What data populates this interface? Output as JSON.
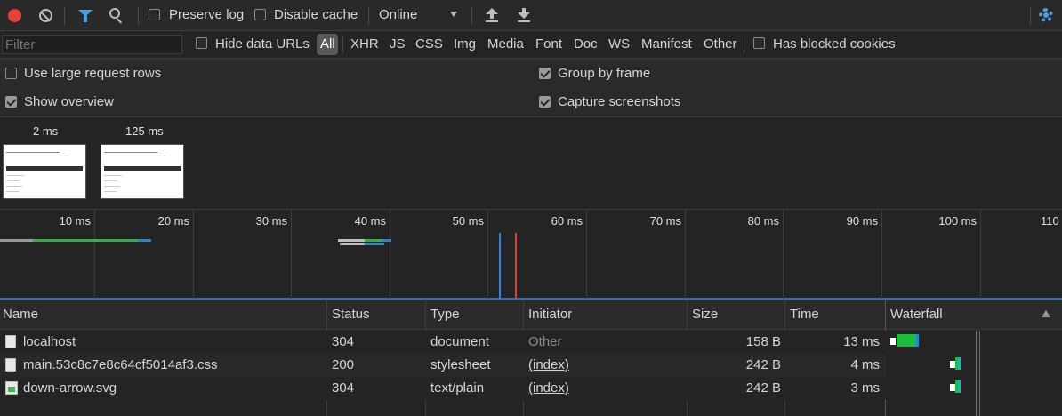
{
  "toolbar": {
    "preserve_log": "Preserve log",
    "disable_cache": "Disable cache",
    "throttling": "Online"
  },
  "filterbar": {
    "placeholder": "Filter",
    "hide_data_urls": "Hide data URLs",
    "types": [
      "All",
      "XHR",
      "JS",
      "CSS",
      "Img",
      "Media",
      "Font",
      "Doc",
      "WS",
      "Manifest",
      "Other"
    ],
    "has_blocked_cookies": "Has blocked cookies"
  },
  "settings": {
    "large_rows": "Use large request rows",
    "show_overview": "Show overview",
    "group_by_frame": "Group by frame",
    "capture_screenshots": "Capture screenshots"
  },
  "screenshots": {
    "times": [
      "2 ms",
      "125 ms"
    ]
  },
  "overview": {
    "ticks": [
      "10 ms",
      "20 ms",
      "30 ms",
      "40 ms",
      "50 ms",
      "60 ms",
      "70 ms",
      "80 ms",
      "90 ms",
      "100 ms",
      "110"
    ]
  },
  "table": {
    "headers": [
      "Name",
      "Status",
      "Type",
      "Initiator",
      "Size",
      "Time",
      "Waterfall"
    ],
    "rows": [
      {
        "name": "localhost",
        "status": "304",
        "type": "document",
        "initiator": "Other",
        "size": "158 B",
        "time": "13 ms"
      },
      {
        "name": "main.53c8c7e8c64cf5014af3.css",
        "status": "200",
        "type": "stylesheet",
        "initiator": "(index)",
        "size": "242 B",
        "time": "4 ms"
      },
      {
        "name": "down-arrow.svg",
        "status": "304",
        "type": "text/plain",
        "initiator": "(index)",
        "size": "242 B",
        "time": "3 ms"
      }
    ]
  },
  "colors": {
    "record_red": "#e5413a",
    "filter_blue": "#4a9ee8",
    "waiting_green": "#1bbd3d",
    "download_blue": "#1e88e5",
    "dom_content_loaded": "#2f80ed",
    "load_red": "#e23b3b"
  },
  "icons": [
    "record-icon",
    "clear-icon",
    "filter-icon",
    "search-icon",
    "dropdown-icon",
    "import-icon",
    "export-icon",
    "settings-gear-icon",
    "sort-arrow-icon",
    "document-file-icon",
    "image-file-icon"
  ]
}
